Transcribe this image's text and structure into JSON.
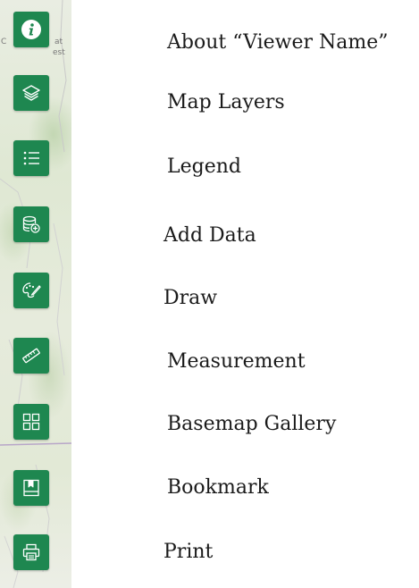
{
  "map": {
    "label_left": "C",
    "label_right_1": "at",
    "label_right_2": "est"
  },
  "tools": [
    {
      "label": "About “Viewer Name”",
      "icon": "info-icon"
    },
    {
      "label": "Map Layers",
      "icon": "layers-icon"
    },
    {
      "label": "Legend",
      "icon": "legend-list-icon"
    },
    {
      "label": "Add Data",
      "icon": "add-data-database-icon"
    },
    {
      "label": "Draw",
      "icon": "palette-brush-icon"
    },
    {
      "label": "Measurement",
      "icon": "ruler-icon"
    },
    {
      "label": "Basemap Gallery",
      "icon": "grid-gallery-icon"
    },
    {
      "label": "Bookmark",
      "icon": "bookmark-icon"
    },
    {
      "label": "Print",
      "icon": "printer-icon"
    }
  ],
  "colors": {
    "button_green": "#1e8750",
    "icon_white": "#ffffff"
  }
}
